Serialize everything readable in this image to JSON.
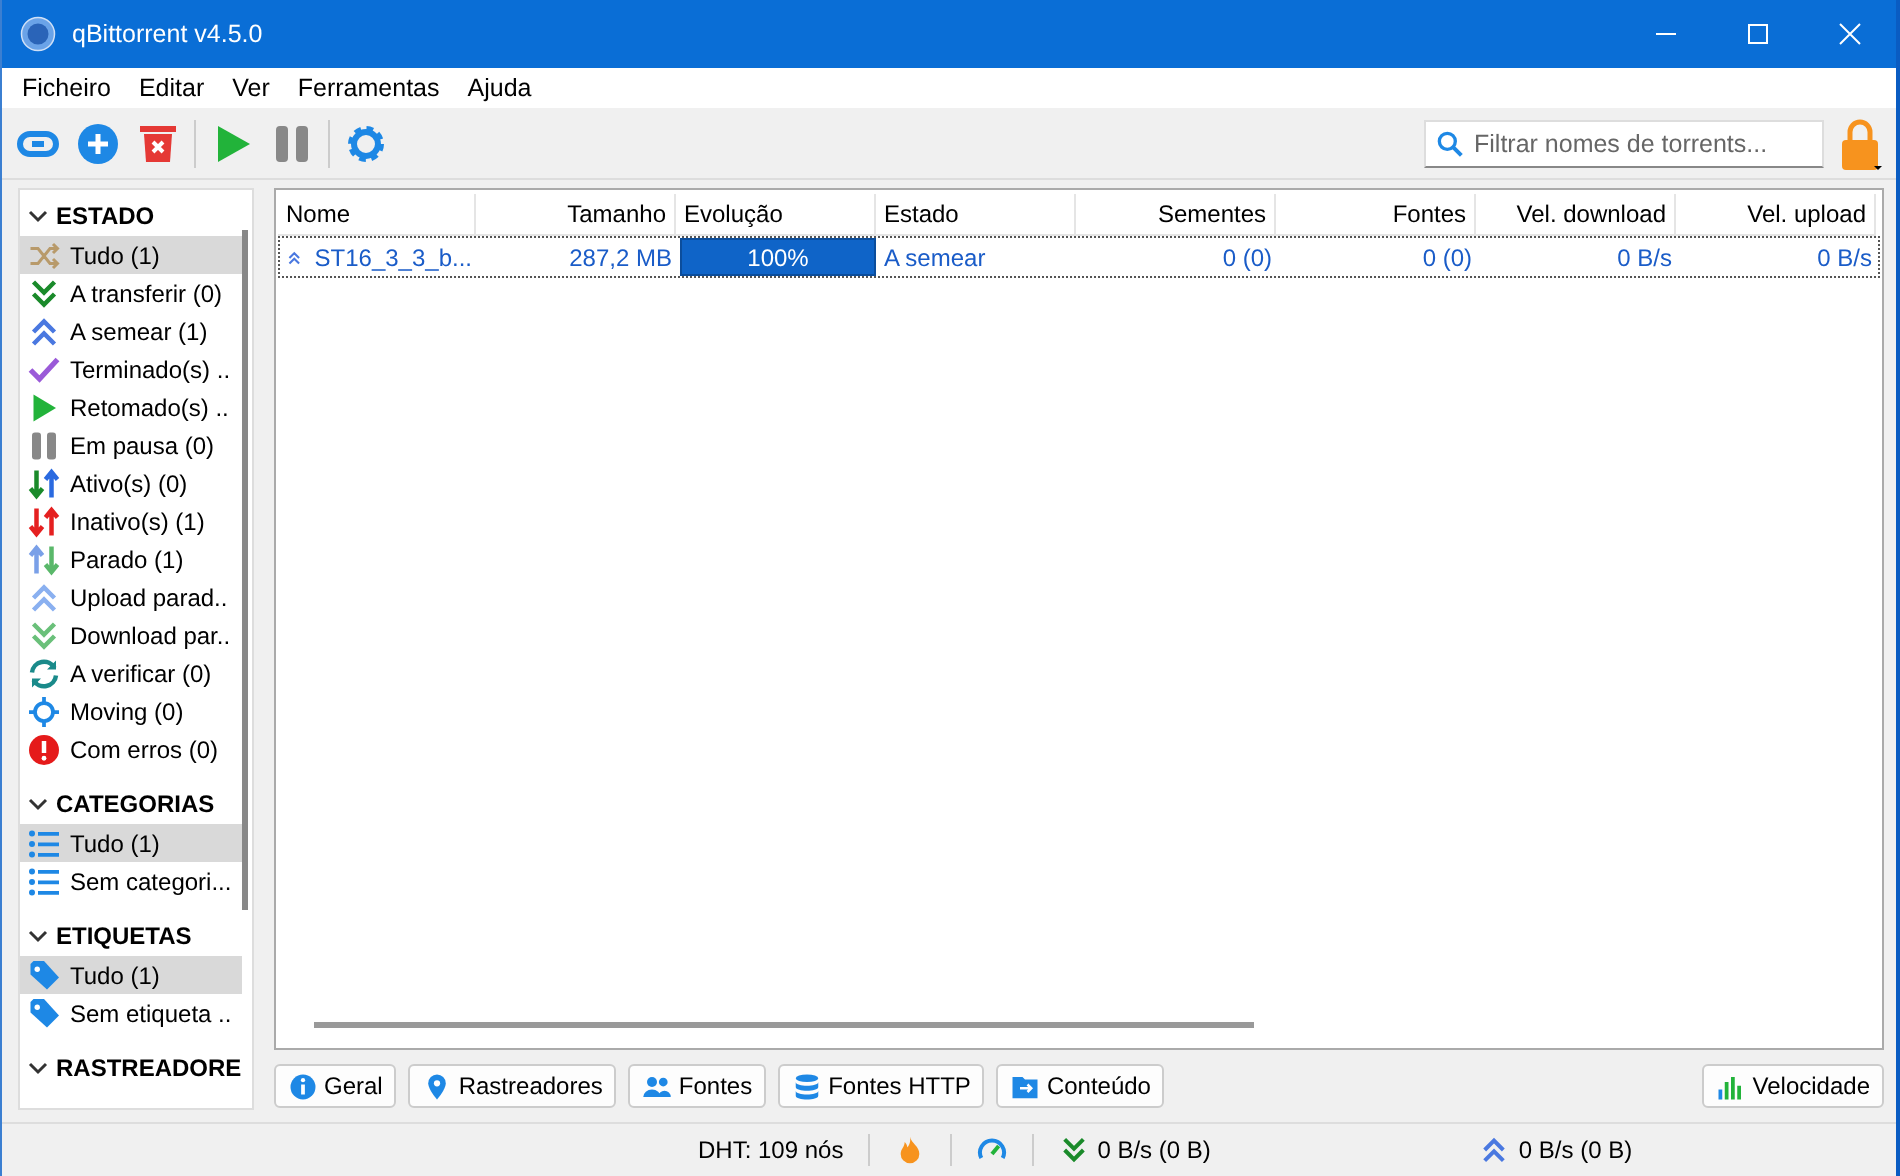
{
  "window": {
    "title": "qBittorrent v4.5.0"
  },
  "menu": [
    "Ficheiro",
    "Editar",
    "Ver",
    "Ferramentas",
    "Ajuda"
  ],
  "toolbar": [
    {
      "kind": "link"
    },
    {
      "kind": "add"
    },
    {
      "kind": "delete"
    },
    {
      "kind": "sep"
    },
    {
      "kind": "play"
    },
    {
      "kind": "pause"
    },
    {
      "kind": "sep"
    },
    {
      "kind": "settings"
    }
  ],
  "search": {
    "placeholder": "Filtrar nomes de torrents..."
  },
  "sidebar": [
    {
      "title": "ESTADO",
      "expanded": true,
      "items": [
        {
          "label": "Tudo (1)",
          "kind": "shuffle",
          "selected": true
        },
        {
          "label": "A transferir (0)",
          "kind": "down",
          "selected": false
        },
        {
          "label": "A semear (1)",
          "kind": "up",
          "selected": false
        },
        {
          "label": "Terminado(s) ..",
          "kind": "check",
          "selected": false
        },
        {
          "label": "Retomado(s) ..",
          "kind": "play",
          "selected": false
        },
        {
          "label": "Em pausa (0)",
          "kind": "pause",
          "selected": false
        },
        {
          "label": "Ativo(s) (0)",
          "kind": "active",
          "selected": false
        },
        {
          "label": "Inativo(s) (1)",
          "kind": "inactive",
          "selected": false
        },
        {
          "label": "Parado (1)",
          "kind": "stalled",
          "selected": false
        },
        {
          "label": "Upload parad..",
          "kind": "uppaused",
          "selected": false
        },
        {
          "label": "Download par..",
          "kind": "downpaused",
          "selected": false
        },
        {
          "label": "A verificar (0)",
          "kind": "checking",
          "selected": false
        },
        {
          "label": "Moving (0)",
          "kind": "moving",
          "selected": false
        },
        {
          "label": "Com erros (0)",
          "kind": "error",
          "selected": false
        }
      ]
    },
    {
      "title": "CATEGORIAS",
      "expanded": true,
      "items": [
        {
          "label": "Tudo (1)",
          "kind": "list",
          "selected": true
        },
        {
          "label": "Sem categori...",
          "kind": "list",
          "selected": false
        }
      ]
    },
    {
      "title": "ETIQUETAS",
      "expanded": true,
      "items": [
        {
          "label": "Tudo (1)",
          "kind": "tag",
          "selected": true
        },
        {
          "label": "Sem etiqueta ..",
          "kind": "tag",
          "selected": false
        }
      ]
    },
    {
      "title": "RASTREADORE",
      "expanded": true
    }
  ],
  "table": {
    "columns": [
      {
        "label": "Nome"
      },
      {
        "label": "Tamanho"
      },
      {
        "label": "Evolução"
      },
      {
        "label": "Estado"
      },
      {
        "label": "Sementes"
      },
      {
        "label": "Fontes"
      },
      {
        "label": "Vel. download"
      },
      {
        "label": "Vel. upload"
      }
    ],
    "rows": [
      {
        "name": "ST16_3_3_b...",
        "size": "287,2 MB",
        "progress": {
          "level": 1,
          "reading": "100%"
        },
        "status": "A semear",
        "seeds": "0 (0)",
        "peers": "0 (0)",
        "down_speed": "0 B/s",
        "up_speed": "0 B/s"
      }
    ]
  },
  "detail_tabs": [
    {
      "label": "Geral",
      "kind": "info"
    },
    {
      "label": "Rastreadores",
      "kind": "pin"
    },
    {
      "label": "Fontes",
      "kind": "people"
    },
    {
      "label": "Fontes HTTP",
      "kind": "db"
    },
    {
      "label": "Conteúdo",
      "kind": "folder"
    }
  ],
  "speed_button": {
    "label": "Velocidade"
  },
  "status_bar": {
    "dht": "DHT: 109 nós",
    "download": "0 B/s (0 B)",
    "upload": "0 B/s (0 B)"
  }
}
